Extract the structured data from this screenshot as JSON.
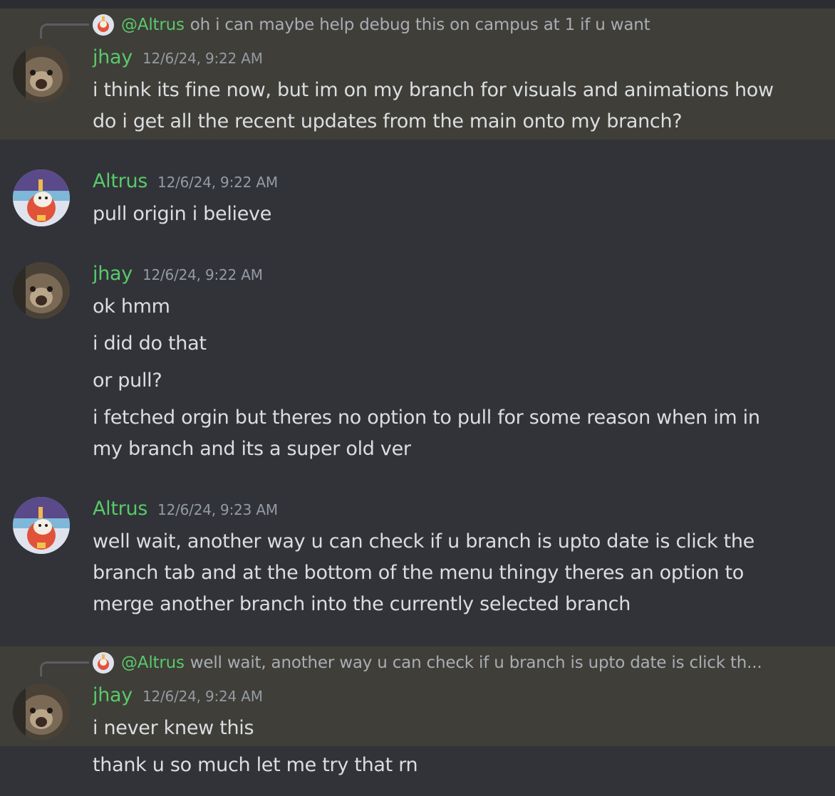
{
  "messages": [
    {
      "author": "jhay",
      "timestamp": "12/6/24, 9:22 AM",
      "reply": {
        "mention": "@Altrus",
        "text": "oh i can maybe help debug this on campus at 1 if u want"
      },
      "lines": [
        "i think its fine now, but im on my branch for visuals and animations how",
        "do i get all the recent updates from the main onto my branch?"
      ]
    },
    {
      "author": "Altrus",
      "timestamp": "12/6/24, 9:22 AM",
      "lines": [
        "pull origin i believe"
      ]
    },
    {
      "author": "jhay",
      "timestamp": "12/6/24, 9:22 AM",
      "lines": [
        "ok  hmm",
        "i did do that",
        "or pull?",
        "i fetched orgin but theres no option to pull for some reason when im in",
        "my branch and its a super old ver"
      ]
    },
    {
      "author": "Altrus",
      "timestamp": "12/6/24, 9:23 AM",
      "lines": [
        "well wait, another way u can check if u branch is upto date is click the",
        "branch tab and at the bottom of the menu thingy theres an option to",
        "merge another branch into the currently selected branch"
      ]
    },
    {
      "author": "jhay",
      "timestamp": "12/6/24, 9:24 AM",
      "reply": {
        "mention": "@Altrus",
        "text": "well wait, another way u can check if u branch is upto date is click th..."
      },
      "lines": [
        "i never knew this",
        "thank u so much let me try that rn"
      ]
    }
  ],
  "colors": {
    "background": "#313338",
    "highlight": "#3f3e38",
    "username": "#59c96b",
    "timestamp": "#949ba4"
  }
}
